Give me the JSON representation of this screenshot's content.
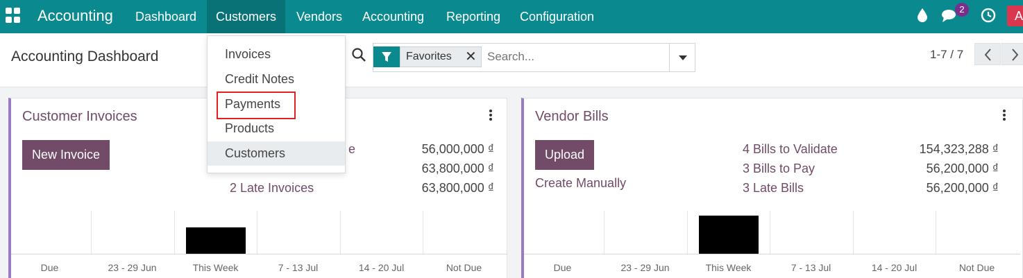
{
  "navbar": {
    "brand": "Accounting",
    "menus": [
      "Dashboard",
      "Customers",
      "Vendors",
      "Accounting",
      "Reporting",
      "Configuration"
    ],
    "chat_badge": "2",
    "avatar_initial": "A",
    "bg_color": "#0a8a8f"
  },
  "dropdown": {
    "items": [
      "Invoices",
      "Credit Notes",
      "Payments",
      "Products",
      "Customers"
    ],
    "highlighted": "Payments",
    "hovered": "Customers"
  },
  "control_panel": {
    "title": "Accounting Dashboard",
    "facet": "Favorites",
    "search_placeholder": "Search...",
    "pager": "1-7 / 7"
  },
  "cards": [
    {
      "title": "Customer Invoices",
      "button": "New Invoice",
      "rows": [
        {
          "label": "e",
          "amount": "56,000,000 ₫"
        },
        {
          "label": "",
          "amount": "63,800,000 ₫"
        },
        {
          "label": "2 Late Invoices",
          "amount": "63,800,000 ₫"
        }
      ],
      "axis": [
        "Due",
        "23 - 29 Jun",
        "This Week",
        "7 - 13 Jul",
        "14 - 20 Jul",
        "Not Due"
      ]
    },
    {
      "title": "Vendor Bills",
      "button": "Upload",
      "secondary": "Create Manually",
      "rows": [
        {
          "label": "4 Bills to Validate",
          "amount": "154,323,288 ₫"
        },
        {
          "label": "3 Bills to Pay",
          "amount": "56,200,000 ₫"
        },
        {
          "label": "3 Late Bills",
          "amount": "56,200,000 ₫"
        }
      ],
      "axis": [
        "Due",
        "23 - 29 Jun",
        "This Week",
        "7 - 13 Jul",
        "14 - 20 Jul",
        "Not Due"
      ]
    }
  ]
}
